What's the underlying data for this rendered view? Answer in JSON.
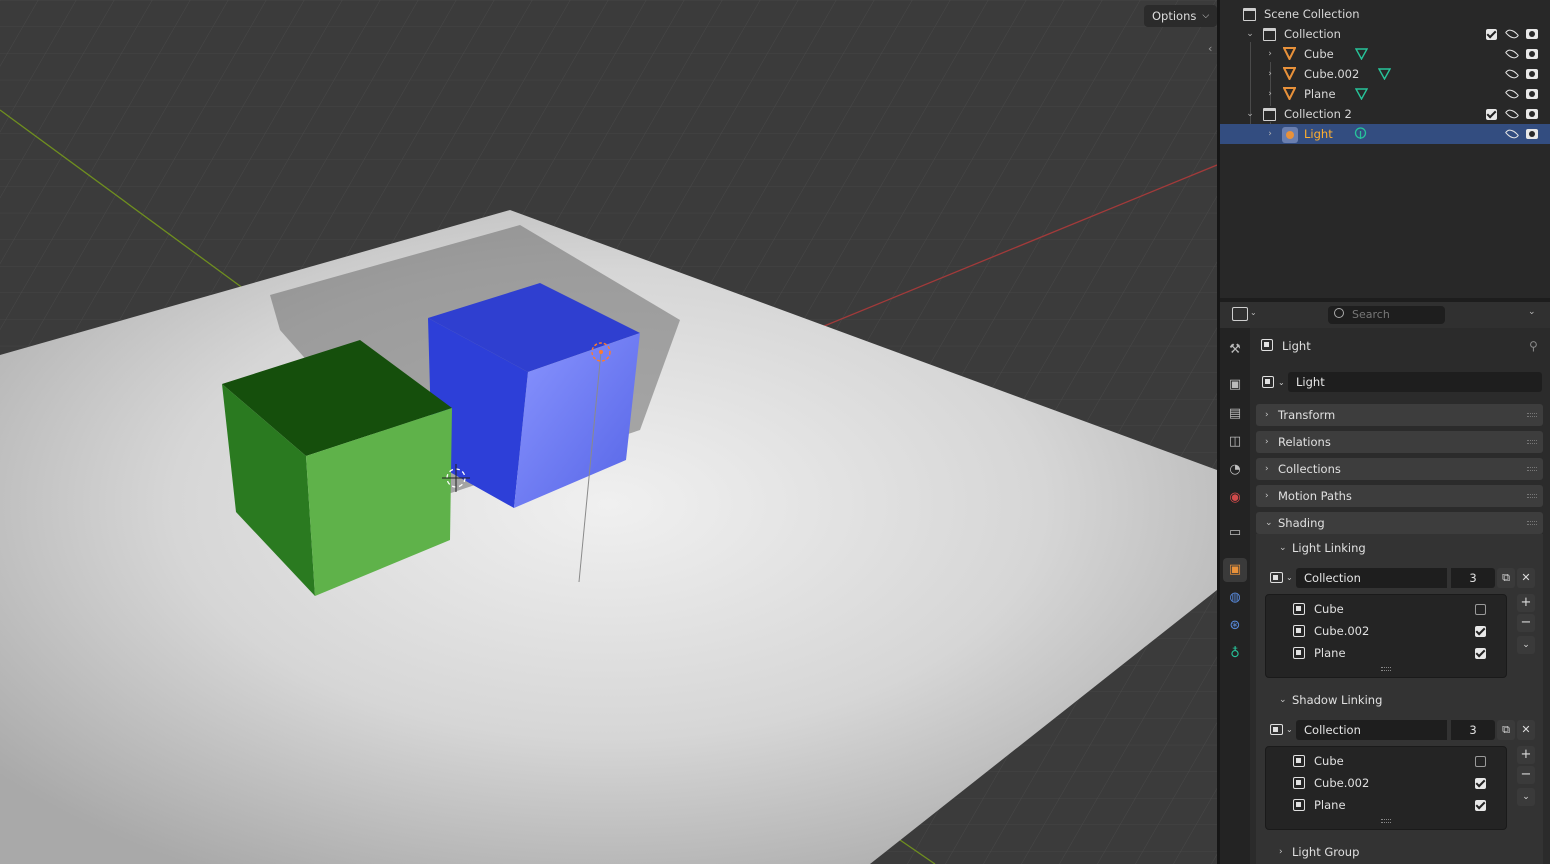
{
  "viewport": {
    "options_label": "Options"
  },
  "outliner": {
    "root": "Scene Collection",
    "items": [
      {
        "label": "Collection",
        "type": "collection",
        "selected": false
      },
      {
        "label": "Cube",
        "type": "mesh",
        "selected": false
      },
      {
        "label": "Cube.002",
        "type": "mesh",
        "selected": false
      },
      {
        "label": "Plane",
        "type": "mesh",
        "selected": false
      },
      {
        "label": "Collection 2",
        "type": "collection",
        "selected": false
      },
      {
        "label": "Light",
        "type": "light",
        "selected": true
      }
    ]
  },
  "properties": {
    "search_placeholder": "Search",
    "object_title": "Light",
    "object_name": "Light",
    "panels": {
      "transform": "Transform",
      "relations": "Relations",
      "collections": "Collections",
      "motion_paths": "Motion Paths",
      "shading": "Shading"
    },
    "light_linking": {
      "title": "Light Linking",
      "collection_name": "Collection",
      "count": "3",
      "items": [
        {
          "name": "Cube",
          "checked": false
        },
        {
          "name": "Cube.002",
          "checked": true
        },
        {
          "name": "Plane",
          "checked": true
        }
      ]
    },
    "shadow_linking": {
      "title": "Shadow Linking",
      "collection_name": "Collection",
      "count": "3",
      "items": [
        {
          "name": "Cube",
          "checked": false
        },
        {
          "name": "Cube.002",
          "checked": true
        },
        {
          "name": "Plane",
          "checked": true
        }
      ]
    },
    "light_group": "Light Group"
  },
  "colors": {
    "selection": "#334d80",
    "selected_text": "#ffaf2f",
    "mesh_icon": "#e8913a",
    "data_icon": "#27c49a",
    "cube_green": "#3f9c2e",
    "cube_blue": "#3d4fd1"
  }
}
